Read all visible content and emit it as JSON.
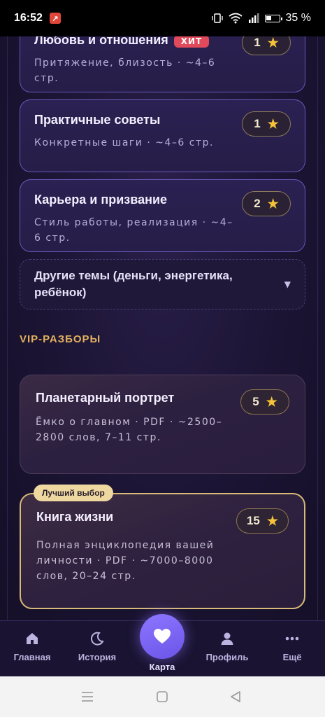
{
  "status_bar": {
    "time": "16:52",
    "battery_text": "35 %",
    "icons": [
      "notification-app-icon",
      "vibrate-icon",
      "wifi-icon",
      "signal-icon",
      "battery-icon"
    ]
  },
  "cards": [
    {
      "title": "Любовь и отношения",
      "badge": "ХИТ",
      "subtitle": "Притяжение, близость · ~4–6 стр.",
      "price": "1"
    },
    {
      "title": "Практичные советы",
      "subtitle": "Конкретные шаги · ~4–6 стр.",
      "price": "1"
    },
    {
      "title": "Карьера и призвание",
      "subtitle": "Стиль работы, реализация · ~4–6 стр.",
      "price": "2"
    }
  ],
  "other_topics": {
    "label": "Другие темы (деньги, энергетика, ребёнок)",
    "icon": "caret-down-icon"
  },
  "vip_section": {
    "title": "VIP-РАЗБОРЫ"
  },
  "vip_cards": [
    {
      "title": "Планетарный портрет",
      "subtitle": "Ёмко о главном · PDF · ~2500–2800 слов, 7–11 стр.",
      "price": "5"
    },
    {
      "badge": "Лучший выбор",
      "title": "Книга жизни",
      "subtitle": "Полная энциклопедия вашей личности · PDF · ~7000–8000 слов, 20–24 стр.",
      "price": "15"
    }
  ],
  "bottom_nav": [
    {
      "label": "Главная",
      "icon": "home-icon"
    },
    {
      "label": "История",
      "icon": "moon-icon"
    },
    {
      "label": "Карта",
      "icon": "heart-icon"
    },
    {
      "label": "Профиль",
      "icon": "person-icon"
    },
    {
      "label": "Ещё",
      "icon": "more-dots-icon"
    }
  ],
  "colors": {
    "accent_gold": "#e3b15e",
    "star": "#f5c23a",
    "badge_red": "#e04a5a",
    "nav_accent": "#7b63f5"
  }
}
